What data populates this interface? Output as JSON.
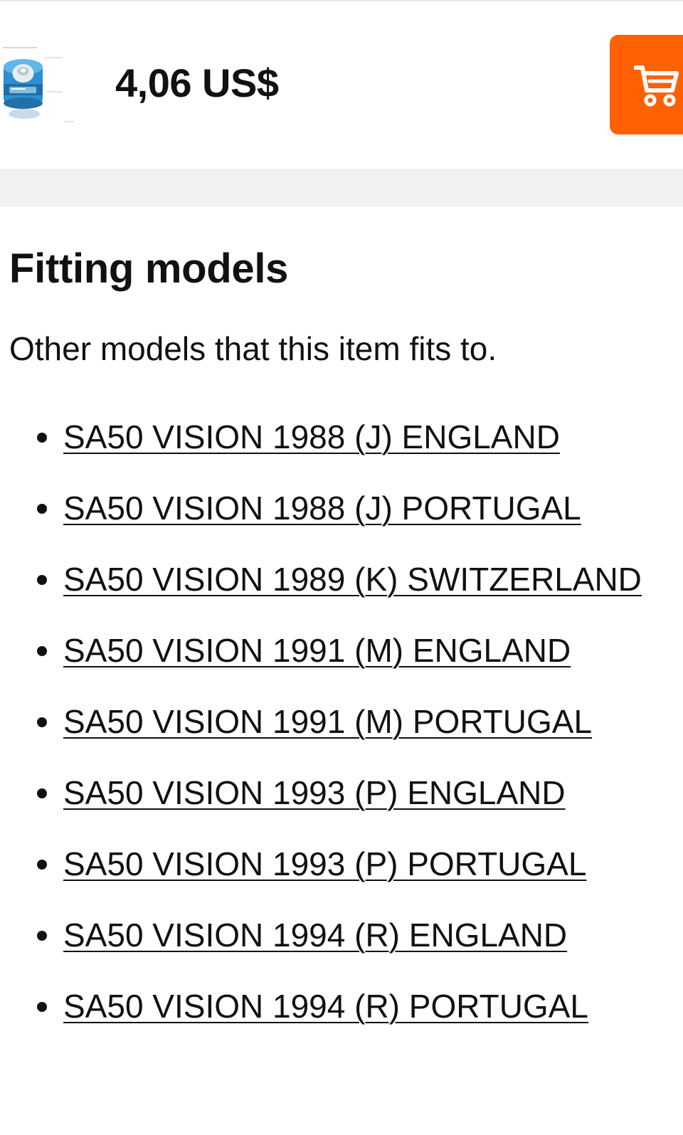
{
  "product": {
    "price": "4,06 US$",
    "thumbnail": "product-thumbnail",
    "cart_button": {
      "icon": "shopping-cart-icon",
      "color": "#ff6000"
    }
  },
  "fitting_models": {
    "title": "Fitting models",
    "subtitle": "Other models that this item fits to.",
    "items": [
      "SA50 VISION 1988 (J) ENGLAND",
      "SA50 VISION 1988 (J) PORTUGAL",
      "SA50 VISION 1989 (K) SWITZERLAND",
      "SA50 VISION 1991 (M) ENGLAND",
      "SA50 VISION 1991 (M) PORTUGAL",
      "SA50 VISION 1993 (P) ENGLAND",
      "SA50 VISION 1993 (P) PORTUGAL",
      "SA50 VISION 1994 (R) ENGLAND",
      "SA50 VISION 1994 (R) PORTUGAL"
    ]
  },
  "colors": {
    "accent": "#ff6000",
    "text": "#111111",
    "band": "#f2f2f3"
  }
}
